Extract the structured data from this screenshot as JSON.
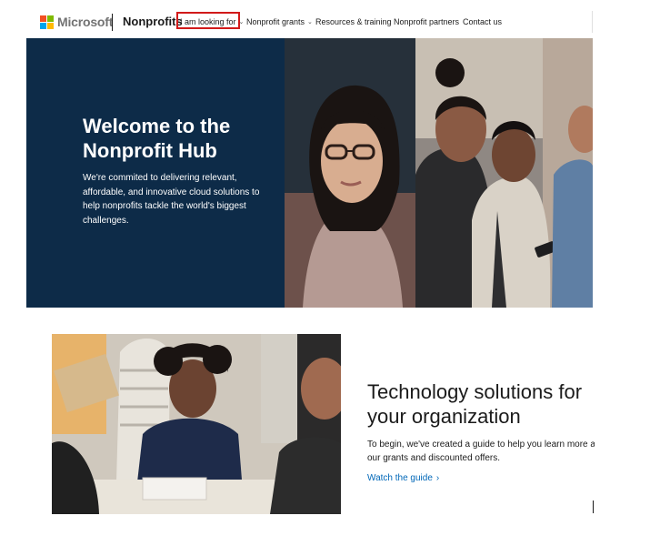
{
  "header": {
    "brand": "Microsoft",
    "section": "Nonprofits",
    "nav": [
      {
        "label": "I am looking for",
        "has_dropdown": true,
        "highlighted": true
      },
      {
        "label": "Nonprofit grants",
        "has_dropdown": true
      },
      {
        "label": "Resources & training",
        "has_dropdown": false
      },
      {
        "label": "Nonprofit partners",
        "has_dropdown": false
      },
      {
        "label": "Contact us",
        "has_dropdown": false
      }
    ],
    "highlight_color": "#d11a1a"
  },
  "hero": {
    "title_line1": "Welcome to the",
    "title_line2": "Nonprofit Hub",
    "body_line1": "We're commited to delivering relevant,",
    "body_line2": "affordable, and innovative cloud solutions to",
    "body_line3": "help nonprofits tackle the world's biggest",
    "body_line4": "challenges.",
    "panel_color": "#0d2b48"
  },
  "feature": {
    "title_line1": "Technology solutions for",
    "title_line2": "your organization",
    "body_line1": "To begin, we've created a guide to help you learn more abo",
    "body_line2": "our grants and discounted offers.",
    "link_label": "Watch the guide",
    "link_icon": "chevron-right-icon",
    "link_color": "#0067b8"
  },
  "logo_colors": [
    "#f25022",
    "#7fba00",
    "#00a4ef",
    "#ffb900"
  ]
}
